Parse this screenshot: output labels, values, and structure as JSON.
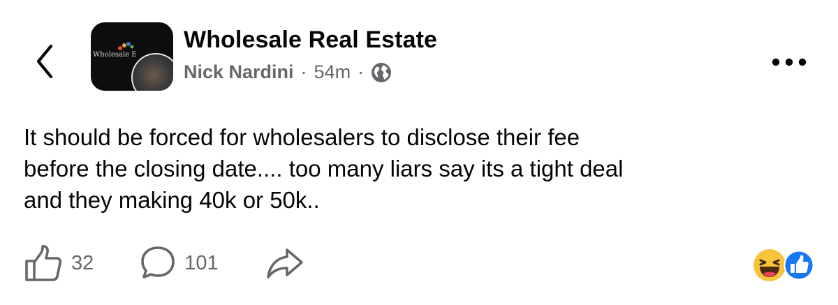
{
  "header": {
    "back_icon": "chevron-left-icon",
    "group_name": "Wholesale Real Estate",
    "avatar": {
      "logo_text": "Wholesale E",
      "dot_colors": [
        "#e04b2f",
        "#e8a33a",
        "#3a78c9",
        "#5bb35b"
      ]
    },
    "author": "Nick Nardini",
    "separator": "·",
    "time": "54m",
    "privacy_icon": "globe-icon",
    "more_icon": "more-dots-icon"
  },
  "post": {
    "text": "It should be forced for wholesalers to disclose their fee\nbefore the closing date....  too many liars say its a tight deal\nand they making 40k or 50k.."
  },
  "actions": {
    "like": {
      "icon": "thumbs-up-icon",
      "count": "32"
    },
    "comment": {
      "icon": "comment-bubble-icon",
      "count": "101"
    },
    "share": {
      "icon": "share-arrow-icon"
    }
  },
  "reactions": {
    "items": [
      "haha",
      "like"
    ],
    "colors": {
      "haha": "#f7c33b",
      "like": "#1877f2"
    }
  },
  "colors": {
    "text": "#050505",
    "secondary": "#65676b",
    "background": "#ffffff"
  }
}
